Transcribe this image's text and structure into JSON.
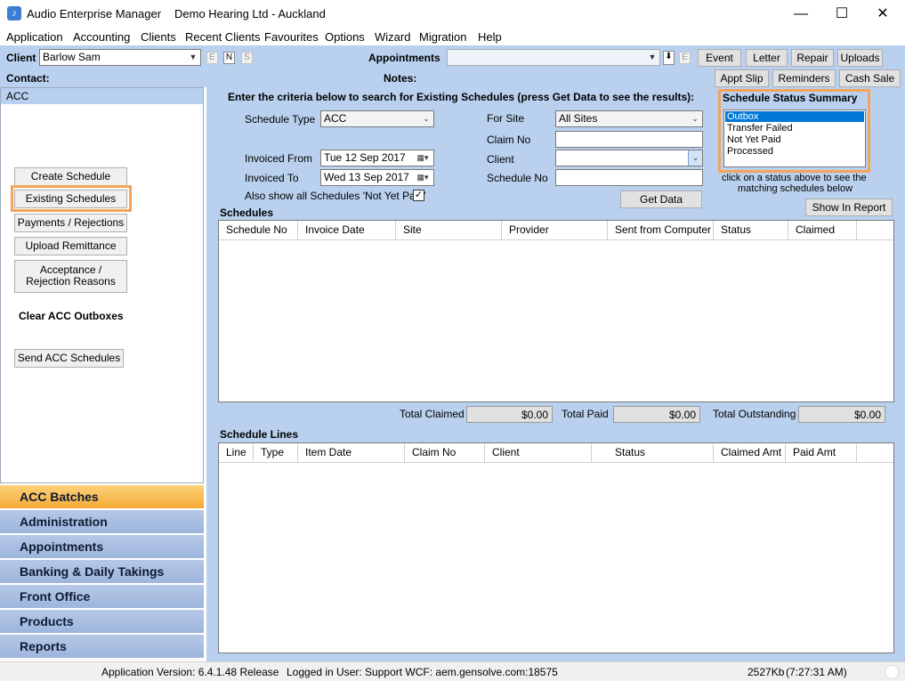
{
  "window": {
    "app_name": "Audio Enterprise Manager",
    "company": "Demo Hearing Ltd - Auckland",
    "minimize": "—",
    "maximize": "☐",
    "close": "✕"
  },
  "menu": [
    "Application",
    "Accounting",
    "Clients",
    "Recent Clients",
    "Favourites",
    "Options",
    "Wizard",
    "Migration",
    "Help"
  ],
  "toolbar": {
    "client_label": "Client",
    "client_value": "Barlow Sam",
    "mini_e": "E",
    "mini_n": "N",
    "mini_s": "S",
    "contact_label": "Contact:",
    "appointments_label": "Appointments",
    "notes_label": "Notes:",
    "buttons": [
      "Event",
      "Letter",
      "Repair",
      "Uploads",
      "Appt Slip",
      "Reminders",
      "Cash Sale"
    ]
  },
  "left_panel": {
    "header": "ACC",
    "create_schedule": "Create Schedule",
    "existing_schedules": "Existing Schedules",
    "payments_rejections": "Payments / Rejections",
    "upload_remittance": "Upload Remittance",
    "acceptance_line1": "Acceptance /",
    "acceptance_line2": "Rejection Reasons",
    "clear_outboxes": "Clear ACC Outboxes",
    "send_schedules": "Send ACC Schedules"
  },
  "nav": [
    "ACC Batches",
    "Administration",
    "Appointments",
    "Banking & Daily Takings",
    "Front Office",
    "Products",
    "Reports"
  ],
  "search": {
    "instruction": "Enter the criteria below to search for Existing Schedules (press Get Data to see the results):",
    "schedule_type_label": "Schedule Type",
    "schedule_type_value": "ACC",
    "invoiced_from_label": "Invoiced From",
    "invoiced_from_value": "Tue  12 Sep 2017",
    "invoiced_to_label": "Invoiced To",
    "invoiced_to_value": "Wed 13 Sep 2017",
    "also_show_label": "Also show all Schedules 'Not Yet Paid'",
    "for_site_label": "For Site",
    "for_site_value": "All Sites",
    "claim_no_label": "Claim No",
    "client_label": "Client",
    "schedule_no_label": "Schedule No",
    "get_data": "Get Data"
  },
  "status_summary": {
    "title": "Schedule Status Summary",
    "items": [
      "Outbox",
      "Transfer Failed",
      "Not Yet Paid",
      "Processed"
    ],
    "hint_line1": "click on a status above to see the",
    "hint_line2": "matching schedules below",
    "show_in_report": "Show In Report"
  },
  "schedules": {
    "title": "Schedules",
    "columns": [
      "Schedule No",
      "Invoice Date",
      "Site",
      "Provider",
      "Sent from Computer",
      "Status",
      "Claimed"
    ]
  },
  "totals": {
    "claimed_label": "Total Claimed",
    "claimed_value": "$0.00",
    "paid_label": "Total Paid",
    "paid_value": "$0.00",
    "outstanding_label": "Total Outstanding",
    "outstanding_value": "$0.00"
  },
  "schedule_lines": {
    "title": "Schedule Lines",
    "columns": [
      "Line",
      "Type",
      "Item Date",
      "Claim No",
      "Client",
      "Status",
      "Claimed Amt",
      "Paid Amt"
    ]
  },
  "statusbar": {
    "version": "Application Version: 6.4.1.48 Release",
    "user": "Logged in User: Support WCF: aem.gensolve.com:18575",
    "memory": "2527Kb",
    "time": "(7:27:31 AM)"
  },
  "colors": {
    "panel_blue": "#b9d1ee",
    "highlight_orange": "#f4a35a",
    "nav_active": "#f5aa36"
  }
}
